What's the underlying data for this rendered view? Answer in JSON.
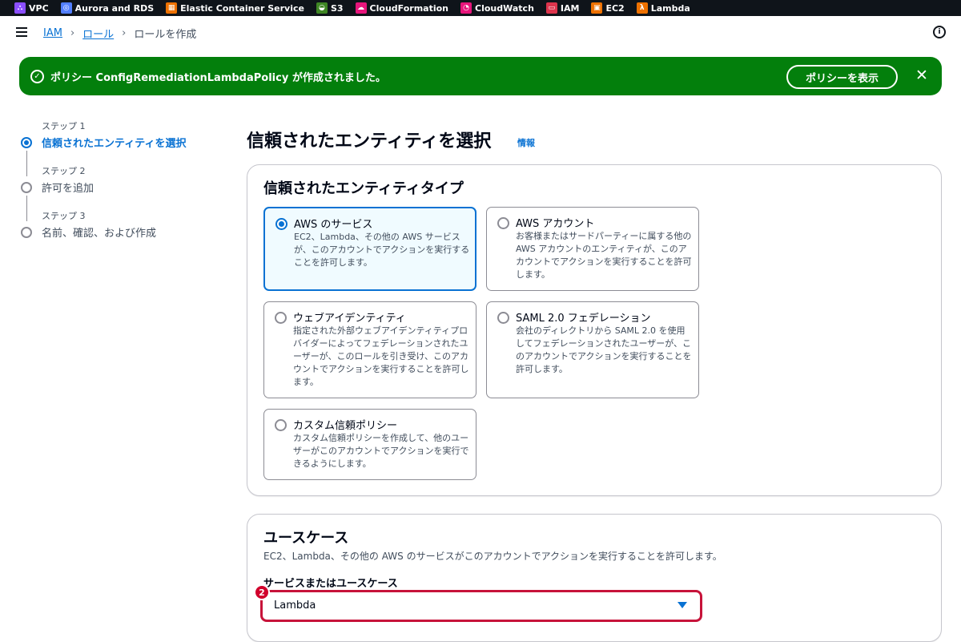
{
  "favorites": [
    {
      "label": "VPC",
      "icon": "vpc-icon",
      "color": "#8c4fff"
    },
    {
      "label": "Aurora and RDS",
      "icon": "rds-icon",
      "color": "#527fff"
    },
    {
      "label": "Elastic Container Service",
      "icon": "ecs-icon",
      "color": "#ed7100"
    },
    {
      "label": "S3",
      "icon": "s3-icon",
      "color": "#3f8624"
    },
    {
      "label": "CloudFormation",
      "icon": "cloudformation-icon",
      "color": "#e7157b"
    },
    {
      "label": "CloudWatch",
      "icon": "cloudwatch-icon",
      "color": "#e7157b"
    },
    {
      "label": "IAM",
      "icon": "iam-icon",
      "color": "#dd344c"
    },
    {
      "label": "EC2",
      "icon": "ec2-icon",
      "color": "#ed7100"
    },
    {
      "label": "Lambda",
      "icon": "lambda-icon",
      "color": "#ed7100"
    }
  ],
  "breadcrumb": {
    "items": [
      "IAM",
      "ロール"
    ],
    "current": "ロールを作成"
  },
  "flash": {
    "message": "ポリシー ConfigRemediationLambdaPolicy が作成されました。",
    "button": "ポリシーを表示",
    "color": "#037f0c"
  },
  "steps": [
    {
      "num": "ステップ 1",
      "label": "信頼されたエンティティを選択",
      "active": true
    },
    {
      "num": "ステップ 2",
      "label": "許可を追加",
      "active": false
    },
    {
      "num": "ステップ 3",
      "label": "名前、確認、および作成",
      "active": false
    }
  ],
  "page": {
    "title": "信頼されたエンティティを選択",
    "info": "情報"
  },
  "entity_type": {
    "title": "信頼されたエンティティタイプ",
    "options": [
      {
        "title": "AWS のサービス",
        "desc": "EC2、Lambda、その他の AWS サービスが、このアカウントでアクションを実行することを許可します。",
        "selected": true
      },
      {
        "title": "AWS アカウント",
        "desc": "お客様またはサードパーティーに属する他の AWS アカウントのエンティティが、このアカウントでアクションを実行することを許可します。",
        "selected": false
      },
      {
        "title": "ウェブアイデンティティ",
        "desc": "指定された外部ウェブアイデンティティプロバイダーによってフェデレーションされたユーザーが、このロールを引き受け、このアカウントでアクションを実行することを許可します。",
        "selected": false
      },
      {
        "title": "SAML 2.0 フェデレーション",
        "desc": "会社のディレクトリから SAML 2.0 を使用してフェデレーションされたユーザーが、このアカウントでアクションを実行することを許可します。",
        "selected": false
      },
      {
        "title": "カスタム信頼ポリシー",
        "desc": "カスタム信頼ポリシーを作成して、他のユーザーがこのアカウントでアクションを実行できるようにします。",
        "selected": false
      }
    ]
  },
  "use_case": {
    "title": "ユースケース",
    "subtitle": "EC2、Lambda、その他の AWS のサービスがこのアカウントでアクションを実行することを許可します。",
    "field_label": "サービスまたはユースケース",
    "value": "Lambda",
    "badge": "2"
  }
}
